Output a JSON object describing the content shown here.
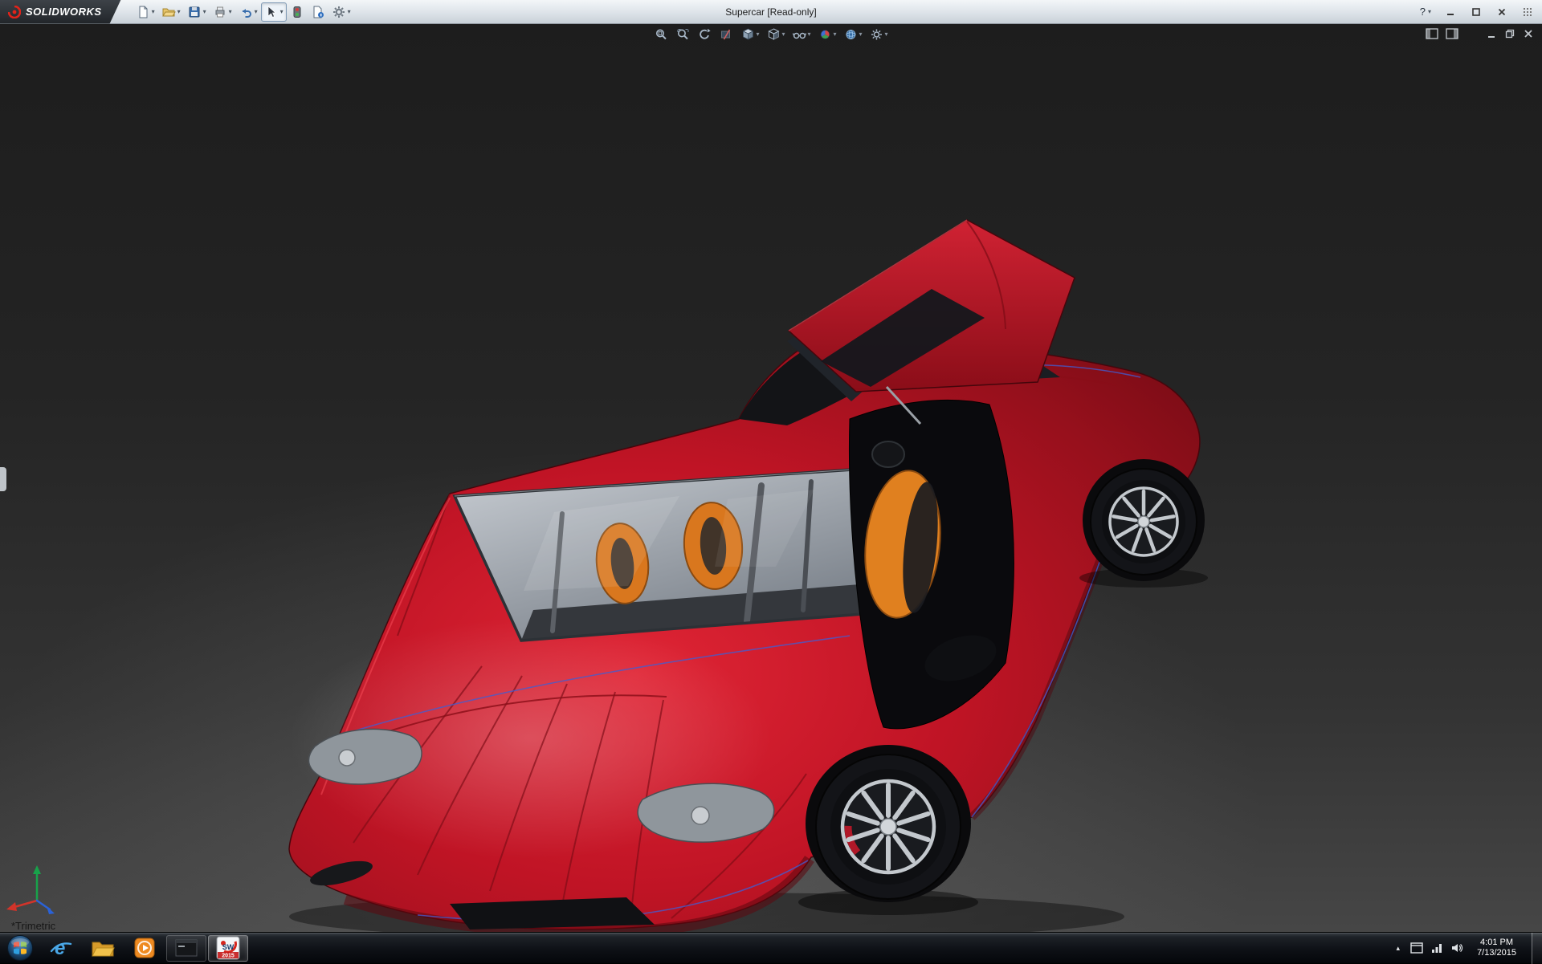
{
  "titlebar": {
    "logo_text": "SOLIDWORKS",
    "title": "Supercar [Read-only]",
    "help_label": "?",
    "toolbar_items": [
      "New",
      "Open",
      "Save",
      "Print",
      "Undo",
      "Select",
      "Rebuild",
      "File Properties",
      "Options"
    ]
  },
  "heads_up": {
    "items": [
      "Zoom to Fit",
      "Zoom to Area",
      "Previous View",
      "Section View",
      "View Orientation",
      "Display Style",
      "Hide/Show Items",
      "Edit Appearance",
      "Apply Scene",
      "View Settings"
    ]
  },
  "viewport": {
    "view_label": "*Trimetric"
  },
  "model": {
    "name": "Supercar",
    "body_color": "#c01425",
    "seat_color": "#e07a1e",
    "glass_color": "#9aa0a8",
    "background_top": "#1d1d1d",
    "background_bottom": "#464646"
  },
  "taskbar": {
    "apps": [
      "Internet Explorer",
      "Windows Explorer",
      "Media Player",
      "Running Application",
      "SolidWorks 2015"
    ],
    "solidworks_badge": {
      "text": "SW",
      "year": "2015"
    },
    "ie_glyph": "e",
    "tray_time": "4:01 PM",
    "tray_date": "7/13/2015"
  },
  "glyphs": {
    "caret": "▾",
    "chevron_up": "▴"
  }
}
